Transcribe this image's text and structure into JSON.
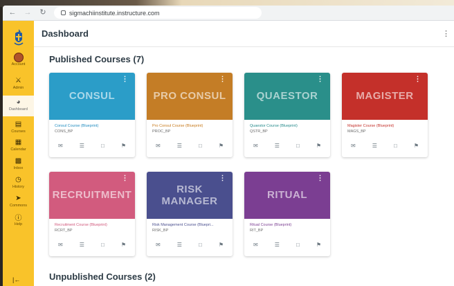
{
  "browser": {
    "url": "sigmachiinstitute.instructure.com"
  },
  "sidebar": {
    "items": [
      {
        "label": "Account",
        "icon": "avatar"
      },
      {
        "label": "Admin",
        "icon": "shield-icon"
      },
      {
        "label": "Dashboard",
        "icon": "dashboard-icon",
        "active": true
      },
      {
        "label": "Courses",
        "icon": "book-icon"
      },
      {
        "label": "Calendar",
        "icon": "calendar-icon"
      },
      {
        "label": "Inbox",
        "icon": "inbox-icon"
      },
      {
        "label": "History",
        "icon": "clock-icon"
      },
      {
        "label": "Commons",
        "icon": "commons-icon"
      },
      {
        "label": "Help",
        "icon": "help-icon"
      }
    ],
    "colors": {
      "background": "#f9c32a"
    }
  },
  "header": {
    "title": "Dashboard"
  },
  "published": {
    "title": "Published Courses (7)",
    "cards": [
      {
        "hero": "CONSUL",
        "name": "Consul Course (Blueprint)",
        "code": "CONS_BP",
        "color": "#2b9dc8",
        "name_color": "#1f8bbf"
      },
      {
        "hero": "PRO CONSUL",
        "name": "Pro Consul Course (Blueprint)",
        "code": "PROC_BP",
        "color": "#c47d26",
        "name_color": "#c77a1c"
      },
      {
        "hero": "QUAESTOR",
        "name": "Quaestor Course (Blueprint)",
        "code": "QSTR_BP",
        "color": "#2a8f8a",
        "name_color": "#23898a"
      },
      {
        "hero": "MAGISTER",
        "name": "Magister Course (Blueprint)",
        "code": "MAGS_BP",
        "color": "#c4302a",
        "name_color": "#c4302a"
      },
      {
        "hero": "RECRUITMENT",
        "name": "Recruitment Course (Blueprint)",
        "code": "RCRT_BP",
        "color": "#d25b7e",
        "name_color": "#d0567a"
      },
      {
        "hero": "RISK\nMANAGER",
        "name": "Risk Management Course (Bluepri...",
        "code": "RISK_BP",
        "color": "#4a4f8e",
        "name_color": "#4a4f8e"
      },
      {
        "hero": "RITUAL",
        "name": "Ritual Course (Blueprint)",
        "code": "RIT_BP",
        "color": "#7b3e92",
        "name_color": "#7b3e92"
      }
    ]
  },
  "unpublished": {
    "title": "Unpublished Courses (2)"
  }
}
